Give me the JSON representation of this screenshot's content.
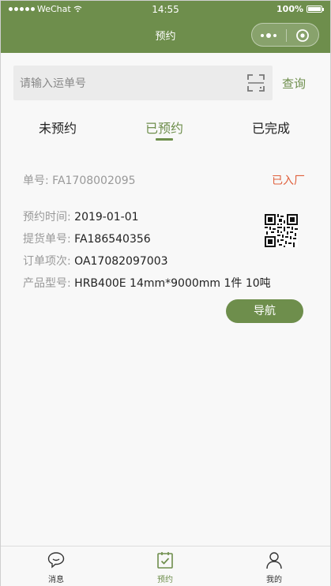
{
  "status_bar": {
    "carrier": "WeChat",
    "time": "14:55",
    "battery": "100%"
  },
  "header": {
    "title": "预约"
  },
  "search": {
    "placeholder": "请输入运单号",
    "query_label": "查询"
  },
  "tabs": [
    {
      "label": "未预约",
      "active": false
    },
    {
      "label": "已预约",
      "active": true
    },
    {
      "label": "已完成",
      "active": false
    }
  ],
  "order": {
    "number_label": "单号:",
    "number_value": "FA1708002095",
    "status": "已入厂",
    "fields": [
      {
        "label": "预约时间:",
        "value": "2019-01-01"
      },
      {
        "label": "提货单号:",
        "value": "FA186540356"
      },
      {
        "label": "订单项次:",
        "value": "OA17082097003"
      },
      {
        "label": "产品型号:",
        "value": "HRB400E 14mm*9000mm 1件 10吨"
      }
    ],
    "nav_button": "导航"
  },
  "tabbar": [
    {
      "label": "消息",
      "icon": "message-icon",
      "active": false
    },
    {
      "label": "预约",
      "icon": "calendar-check-icon",
      "active": true
    },
    {
      "label": "我的",
      "icon": "user-icon",
      "active": false
    }
  ],
  "colors": {
    "brand": "#6e8e4c",
    "status_tag": "#e0603d"
  }
}
